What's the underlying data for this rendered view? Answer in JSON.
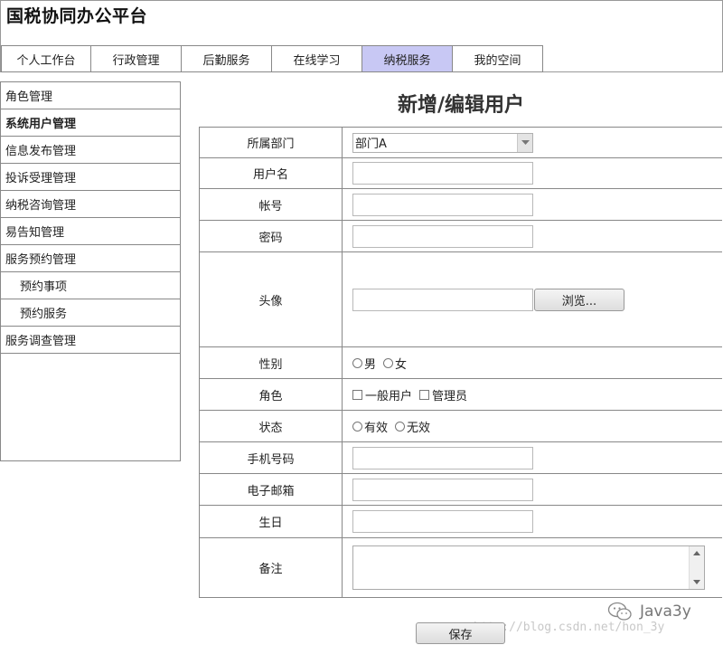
{
  "header": {
    "title": "国税协同办公平台",
    "tabs": [
      {
        "label": "个人工作台",
        "active": false
      },
      {
        "label": "行政管理",
        "active": false
      },
      {
        "label": "后勤服务",
        "active": false
      },
      {
        "label": "在线学习",
        "active": false
      },
      {
        "label": "纳税服务",
        "active": true
      },
      {
        "label": "我的空间",
        "active": false
      }
    ]
  },
  "sidebar": {
    "items": [
      {
        "label": "角色管理"
      },
      {
        "label": "系统用户管理",
        "selected": true
      },
      {
        "label": "信息发布管理"
      },
      {
        "label": "投诉受理管理"
      },
      {
        "label": "纳税咨询管理"
      },
      {
        "label": "易告知管理"
      },
      {
        "label": "服务预约管理"
      },
      {
        "label": "预约事项",
        "sub": true
      },
      {
        "label": "预约服务",
        "sub": true
      },
      {
        "label": "服务调查管理"
      }
    ]
  },
  "main": {
    "title": "新增/编辑用户",
    "form": {
      "dept": {
        "label": "所属部门",
        "value": "部门A"
      },
      "username": {
        "label": "用户名",
        "value": ""
      },
      "account": {
        "label": "帐号",
        "value": ""
      },
      "password": {
        "label": "密码",
        "value": ""
      },
      "avatar": {
        "label": "头像",
        "value": "",
        "browse_label": "浏览..."
      },
      "gender": {
        "label": "性别",
        "options": [
          "男",
          "女"
        ]
      },
      "role": {
        "label": "角色",
        "options": [
          "一般用户",
          "管理员"
        ]
      },
      "status": {
        "label": "状态",
        "options": [
          "有效",
          "无效"
        ]
      },
      "mobile": {
        "label": "手机号码",
        "value": ""
      },
      "email": {
        "label": "电子邮箱",
        "value": ""
      },
      "birthday": {
        "label": "生日",
        "value": ""
      },
      "remark": {
        "label": "备注",
        "value": ""
      }
    },
    "save_label": "保存"
  },
  "watermark": {
    "url": "http://blog.csdn.net/hon_3y",
    "brand": "Java3y"
  }
}
